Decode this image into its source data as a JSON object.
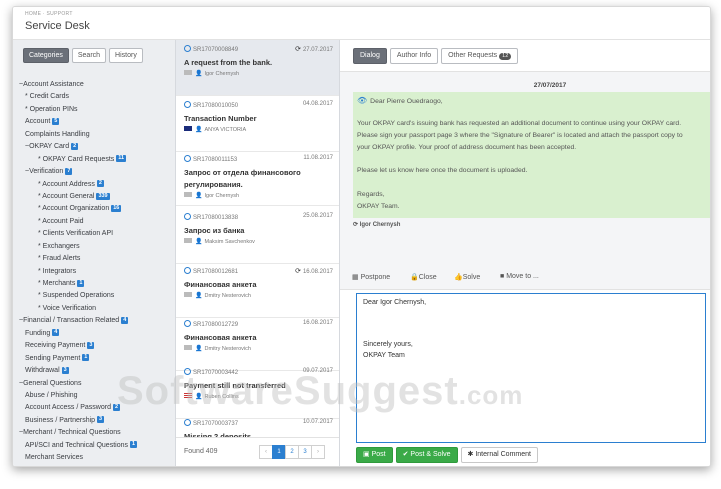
{
  "header": {
    "breadcrumb": "HOME · SUPPORT",
    "title": "Service Desk"
  },
  "sidebar": {
    "tabs": [
      {
        "label": "Categories",
        "active": true
      },
      {
        "label": "Search",
        "active": false
      },
      {
        "label": "History",
        "active": false
      }
    ],
    "tree": [
      {
        "label": "~Account Assistance",
        "indent": 0
      },
      {
        "label": "* Credit Cards",
        "indent": 1
      },
      {
        "label": "* Operation PINs",
        "indent": 1
      },
      {
        "label": "Account",
        "indent": 1,
        "badge": "5"
      },
      {
        "label": "Complaints Handling",
        "indent": 1
      },
      {
        "label": "~OKPAY Card",
        "indent": 1,
        "badge": "2"
      },
      {
        "label": "* OKPAY Card Requests",
        "indent": 2,
        "badge": "11"
      },
      {
        "label": "~Verification",
        "indent": 1,
        "badge": "7"
      },
      {
        "label": "* Account Address",
        "indent": 2,
        "badge": "2"
      },
      {
        "label": "* Account General",
        "indent": 2,
        "badge": "339"
      },
      {
        "label": "* Account Organization",
        "indent": 2,
        "badge": "16"
      },
      {
        "label": "* Account Paid",
        "indent": 2
      },
      {
        "label": "* Clients Verification API",
        "indent": 2
      },
      {
        "label": "* Exchangers",
        "indent": 2
      },
      {
        "label": "* Fraud Alerts",
        "indent": 2
      },
      {
        "label": "* Integrators",
        "indent": 2
      },
      {
        "label": "* Merchants",
        "indent": 2,
        "badge": "1"
      },
      {
        "label": "* Suspended Operations",
        "indent": 2
      },
      {
        "label": "* Voice Verification",
        "indent": 2
      },
      {
        "label": "~Financial / Transaction Related",
        "indent": 0,
        "badge": "4"
      },
      {
        "label": "Funding",
        "indent": 1,
        "badge": "4"
      },
      {
        "label": "Receiving Payment",
        "indent": 1,
        "badge": "3"
      },
      {
        "label": "Sending Payment",
        "indent": 1,
        "badge": "1"
      },
      {
        "label": "Withdrawal",
        "indent": 1,
        "badge": "3"
      },
      {
        "label": "~General Questions",
        "indent": 0
      },
      {
        "label": "Abuse / Phishing",
        "indent": 1
      },
      {
        "label": "Account Access / Password",
        "indent": 1,
        "badge": "2"
      },
      {
        "label": "Business / Partnership",
        "indent": 1,
        "badge": "3"
      },
      {
        "label": "~Merchant / Technical Questions",
        "indent": 0
      },
      {
        "label": "API/SCI and Technical Questions",
        "indent": 1,
        "badge": "1"
      },
      {
        "label": "Merchant Services",
        "indent": 1
      }
    ]
  },
  "tickets": [
    {
      "id": "SR17070008849",
      "date": "27.07.2017",
      "sync": true,
      "subject": "A request from the bank.",
      "author": "Igor Chernysh",
      "flag": "none",
      "selected": true
    },
    {
      "id": "SR17080010050",
      "date": "04.08.2017",
      "sync": false,
      "subject": "Transaction Number",
      "author": "ANYA VICTORIA",
      "flag": "au",
      "selected": false
    },
    {
      "id": "SR17080011153",
      "date": "11.08.2017",
      "sync": false,
      "subject": "Запрос от отдела финансового регулирования.",
      "author": "Igor Chernysh",
      "flag": "none",
      "selected": false
    },
    {
      "id": "SR17080013838",
      "date": "25.08.2017",
      "sync": false,
      "subject": "Запрос из банка",
      "author": "Maksim Savchenkov",
      "flag": "none",
      "selected": false
    },
    {
      "id": "SR17080012681",
      "date": "16.08.2017",
      "sync": true,
      "subject": "Финансовая анкета",
      "author": "Dmitry Nesterovich",
      "flag": "none",
      "selected": false
    },
    {
      "id": "SR17080012729",
      "date": "16.08.2017",
      "sync": false,
      "subject": "Финансовая анкета",
      "author": "Dmitry Nesterovich",
      "flag": "none",
      "selected": false
    },
    {
      "id": "SR17070003442",
      "date": "09.07.2017",
      "sync": false,
      "subject": "Payment still not transferred",
      "author": "Ruben Collins",
      "flag": "us",
      "selected": false
    },
    {
      "id": "SR17070003737",
      "date": "10.07.2017",
      "sync": false,
      "subject": "Missing 2 deposits",
      "author": "",
      "flag": "none",
      "selected": false
    }
  ],
  "list_footer": {
    "found": "Found 409",
    "pages": [
      "‹",
      "1",
      "2",
      "3",
      "›"
    ],
    "active_page": "1"
  },
  "detail": {
    "tabs": [
      {
        "label": "Dialog",
        "active": true
      },
      {
        "label": "Author Info",
        "active": false
      },
      {
        "label": "Other Requests",
        "active": false,
        "count": "12"
      }
    ],
    "message_date": "27/07/2017",
    "message": {
      "greeting": "Dear Pierre Ouedraogo,",
      "p1": "Your OKPAY card's issuing bank has requested an additional document to continue using your OKPAY card.",
      "p2": "Please sign your passport page 3 where the \"Signature of Bearer\" is located and attach the passport copy to",
      "p3": "your OKPAY profile. Your proof of address document has been accepted.",
      "p4": "Please let us know here once the document is uploaded.",
      "p5": "Regards,",
      "p6": "OKPAY Team."
    },
    "message_author": "Igor Chernysh",
    "actions": {
      "postpone": "Postpone",
      "close": "Close",
      "solve": "Solve",
      "move": "Move to ..."
    },
    "reply": {
      "l1": "Dear Igor Chernysh,",
      "l2": "Sincerely yours,",
      "l3": "OKPAY Team"
    },
    "buttons": {
      "post": "Post",
      "post_solve": "Post & Solve",
      "internal": "Internal Comment"
    }
  },
  "watermark": {
    "main": "SoftwareSuggest",
    "suffix": ".com"
  },
  "colors": {
    "accent": "#2b7fd0",
    "message_bg": "#d9f0cf",
    "green": "#3aaa48"
  }
}
